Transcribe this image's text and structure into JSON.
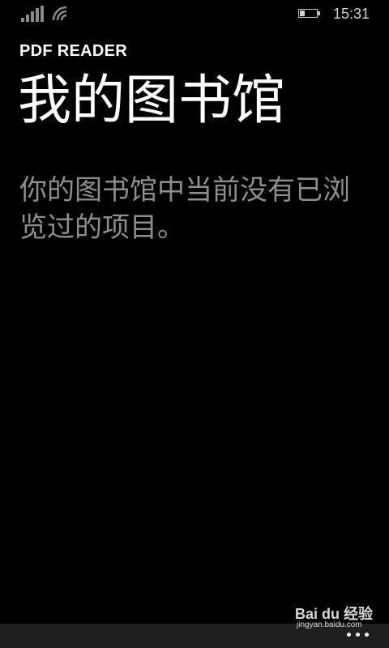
{
  "status_bar": {
    "time": "15:31",
    "signal_icon": "signal-bars-icon",
    "wifi_icon": "wifi-icon",
    "battery_icon": "battery-icon",
    "battery_level": 0.3
  },
  "header": {
    "app_name": "PDF READER",
    "title": "我的图书馆"
  },
  "main": {
    "empty_message": "你的图书馆中当前没有已浏览过的项目。"
  },
  "app_bar": {
    "more_icon": "more-dots-icon"
  },
  "watermark": {
    "brand": "Bai du 经验",
    "url": "jingyan.baidu.com"
  },
  "colors": {
    "background": "#000000",
    "primary_text": "#ffffff",
    "secondary_text": "#8e8e8e",
    "app_bar": "#1f1f1f"
  }
}
